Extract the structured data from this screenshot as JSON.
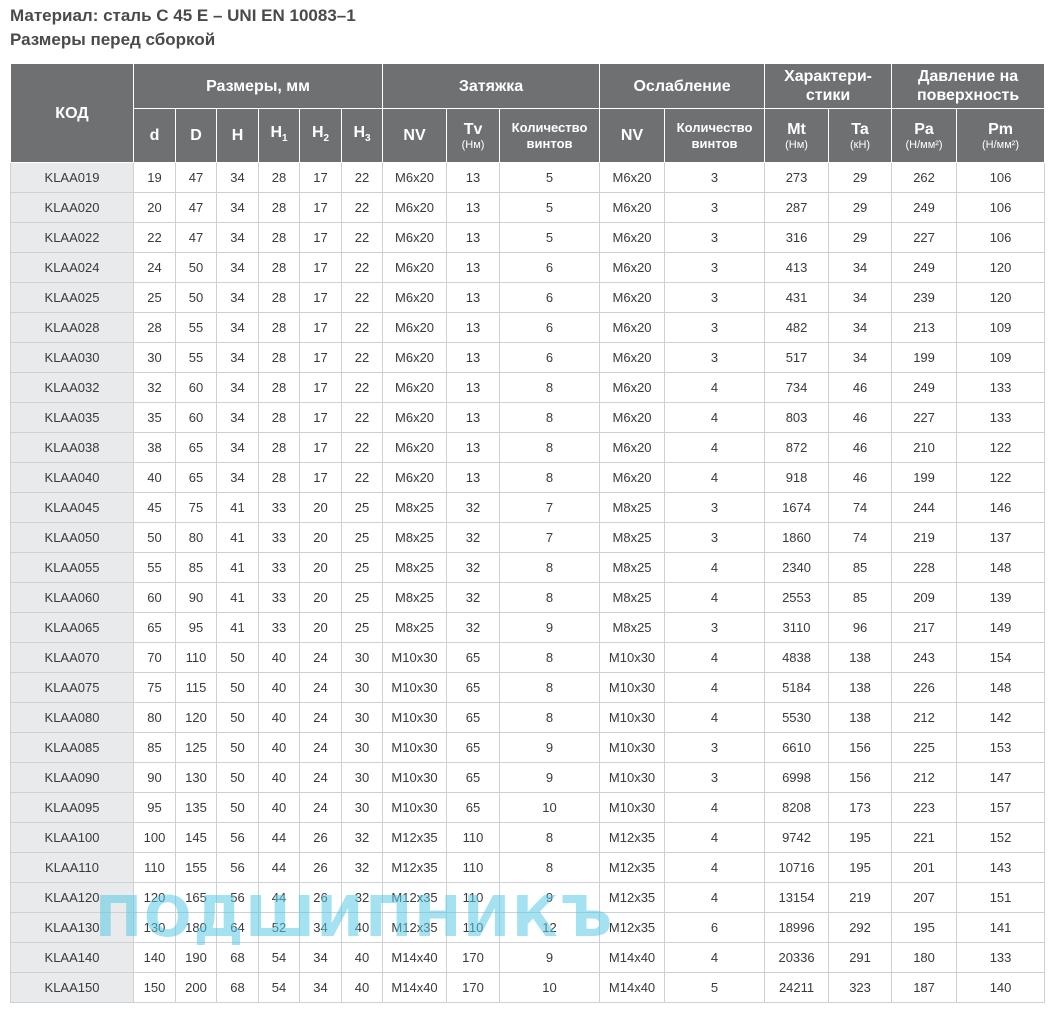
{
  "header": {
    "material": "Материал: сталь C 45 E – UNI EN 10083–1",
    "subtitle": "Размеры перед сборкой"
  },
  "table": {
    "groups": {
      "code": "КОД",
      "dims": "Размеры, мм",
      "tighten": "Затяжка",
      "loosen": "Ослабление",
      "chars": "Характери-стики",
      "pressure": "Давление на поверхность"
    },
    "subheaders": {
      "d": "d",
      "D": "D",
      "H": "H",
      "H1": "H",
      "H1_sub": "1",
      "H2": "H",
      "H2_sub": "2",
      "H3": "H",
      "H3_sub": "3",
      "nv1": "NV",
      "tv": "Tv",
      "tv_unit": "(Нм)",
      "qty1": "Количество винтов",
      "nv2": "NV",
      "qty2": "Количество винтов",
      "mt": "Mt",
      "mt_unit": "(Нм)",
      "ta": "Ta",
      "ta_unit": "(кН)",
      "pa": "Pa",
      "pa_unit": "(Н/мм²)",
      "pm": "Pm",
      "pm_unit": "(Н/мм²)"
    },
    "rows": [
      [
        "KLAA019",
        "19",
        "47",
        "34",
        "28",
        "17",
        "22",
        "M6x20",
        "13",
        "5",
        "M6x20",
        "3",
        "273",
        "29",
        "262",
        "106"
      ],
      [
        "KLAA020",
        "20",
        "47",
        "34",
        "28",
        "17",
        "22",
        "M6x20",
        "13",
        "5",
        "M6x20",
        "3",
        "287",
        "29",
        "249",
        "106"
      ],
      [
        "KLAA022",
        "22",
        "47",
        "34",
        "28",
        "17",
        "22",
        "M6x20",
        "13",
        "5",
        "M6x20",
        "3",
        "316",
        "29",
        "227",
        "106"
      ],
      [
        "KLAA024",
        "24",
        "50",
        "34",
        "28",
        "17",
        "22",
        "M6x20",
        "13",
        "6",
        "M6x20",
        "3",
        "413",
        "34",
        "249",
        "120"
      ],
      [
        "KLAA025",
        "25",
        "50",
        "34",
        "28",
        "17",
        "22",
        "M6x20",
        "13",
        "6",
        "M6x20",
        "3",
        "431",
        "34",
        "239",
        "120"
      ],
      [
        "KLAA028",
        "28",
        "55",
        "34",
        "28",
        "17",
        "22",
        "M6x20",
        "13",
        "6",
        "M6x20",
        "3",
        "482",
        "34",
        "213",
        "109"
      ],
      [
        "KLAA030",
        "30",
        "55",
        "34",
        "28",
        "17",
        "22",
        "M6x20",
        "13",
        "6",
        "M6x20",
        "3",
        "517",
        "34",
        "199",
        "109"
      ],
      [
        "KLAA032",
        "32",
        "60",
        "34",
        "28",
        "17",
        "22",
        "M6x20",
        "13",
        "8",
        "M6x20",
        "4",
        "734",
        "46",
        "249",
        "133"
      ],
      [
        "KLAA035",
        "35",
        "60",
        "34",
        "28",
        "17",
        "22",
        "M6x20",
        "13",
        "8",
        "M6x20",
        "4",
        "803",
        "46",
        "227",
        "133"
      ],
      [
        "KLAA038",
        "38",
        "65",
        "34",
        "28",
        "17",
        "22",
        "M6x20",
        "13",
        "8",
        "M6x20",
        "4",
        "872",
        "46",
        "210",
        "122"
      ],
      [
        "KLAA040",
        "40",
        "65",
        "34",
        "28",
        "17",
        "22",
        "M6x20",
        "13",
        "8",
        "M6x20",
        "4",
        "918",
        "46",
        "199",
        "122"
      ],
      [
        "KLAA045",
        "45",
        "75",
        "41",
        "33",
        "20",
        "25",
        "M8x25",
        "32",
        "7",
        "M8x25",
        "3",
        "1674",
        "74",
        "244",
        "146"
      ],
      [
        "KLAA050",
        "50",
        "80",
        "41",
        "33",
        "20",
        "25",
        "M8x25",
        "32",
        "7",
        "M8x25",
        "3",
        "1860",
        "74",
        "219",
        "137"
      ],
      [
        "KLAA055",
        "55",
        "85",
        "41",
        "33",
        "20",
        "25",
        "M8x25",
        "32",
        "8",
        "M8x25",
        "4",
        "2340",
        "85",
        "228",
        "148"
      ],
      [
        "KLAA060",
        "60",
        "90",
        "41",
        "33",
        "20",
        "25",
        "M8x25",
        "32",
        "8",
        "M8x25",
        "4",
        "2553",
        "85",
        "209",
        "139"
      ],
      [
        "KLAA065",
        "65",
        "95",
        "41",
        "33",
        "20",
        "25",
        "M8x25",
        "32",
        "9",
        "M8x25",
        "3",
        "3110",
        "96",
        "217",
        "149"
      ],
      [
        "KLAA070",
        "70",
        "110",
        "50",
        "40",
        "24",
        "30",
        "M10x30",
        "65",
        "8",
        "M10x30",
        "4",
        "4838",
        "138",
        "243",
        "154"
      ],
      [
        "KLAA075",
        "75",
        "115",
        "50",
        "40",
        "24",
        "30",
        "M10x30",
        "65",
        "8",
        "M10x30",
        "4",
        "5184",
        "138",
        "226",
        "148"
      ],
      [
        "KLAA080",
        "80",
        "120",
        "50",
        "40",
        "24",
        "30",
        "M10x30",
        "65",
        "8",
        "M10x30",
        "4",
        "5530",
        "138",
        "212",
        "142"
      ],
      [
        "KLAA085",
        "85",
        "125",
        "50",
        "40",
        "24",
        "30",
        "M10x30",
        "65",
        "9",
        "M10x30",
        "3",
        "6610",
        "156",
        "225",
        "153"
      ],
      [
        "KLAA090",
        "90",
        "130",
        "50",
        "40",
        "24",
        "30",
        "M10x30",
        "65",
        "9",
        "M10x30",
        "3",
        "6998",
        "156",
        "212",
        "147"
      ],
      [
        "KLAA095",
        "95",
        "135",
        "50",
        "40",
        "24",
        "30",
        "M10x30",
        "65",
        "10",
        "M10x30",
        "4",
        "8208",
        "173",
        "223",
        "157"
      ],
      [
        "KLAA100",
        "100",
        "145",
        "56",
        "44",
        "26",
        "32",
        "M12x35",
        "110",
        "8",
        "M12x35",
        "4",
        "9742",
        "195",
        "221",
        "152"
      ],
      [
        "KLAA110",
        "110",
        "155",
        "56",
        "44",
        "26",
        "32",
        "M12x35",
        "110",
        "8",
        "M12x35",
        "4",
        "10716",
        "195",
        "201",
        "143"
      ],
      [
        "KLAA120",
        "120",
        "165",
        "56",
        "44",
        "26",
        "32",
        "M12x35",
        "110",
        "9",
        "M12x35",
        "4",
        "13154",
        "219",
        "207",
        "151"
      ],
      [
        "KLAA130",
        "130",
        "180",
        "64",
        "52",
        "34",
        "40",
        "M12x35",
        "110",
        "12",
        "M12x35",
        "6",
        "18996",
        "292",
        "195",
        "141"
      ],
      [
        "KLAA140",
        "140",
        "190",
        "68",
        "54",
        "34",
        "40",
        "M14x40",
        "170",
        "9",
        "M14x40",
        "4",
        "20336",
        "291",
        "180",
        "133"
      ],
      [
        "KLAA150",
        "150",
        "200",
        "68",
        "54",
        "34",
        "40",
        "M14x40",
        "170",
        "10",
        "M14x40",
        "5",
        "24211",
        "323",
        "187",
        "140"
      ]
    ]
  },
  "watermark": "ПОДШИПНИКЪ"
}
